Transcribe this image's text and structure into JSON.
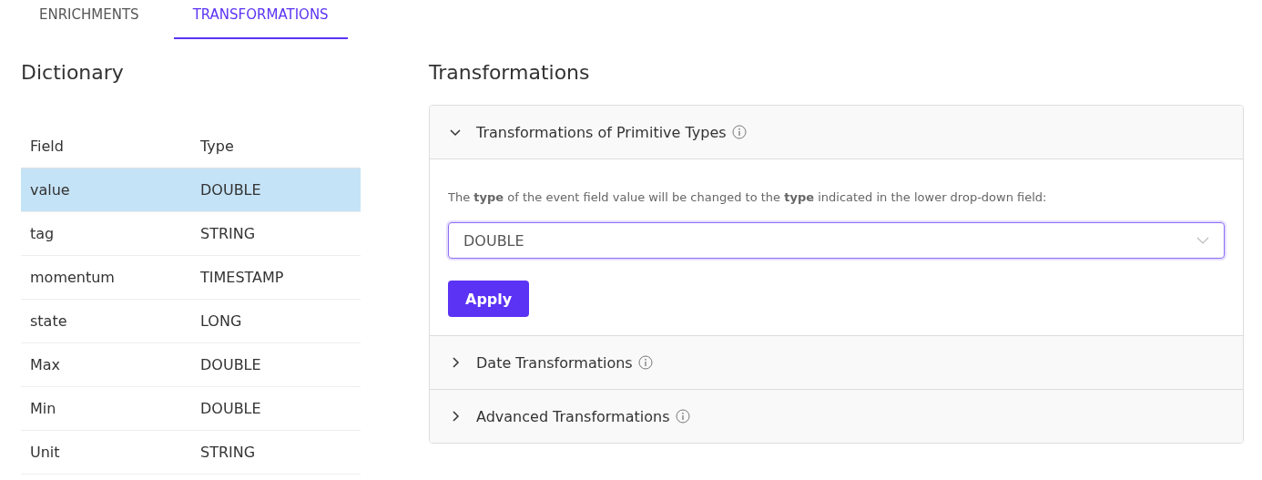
{
  "tabs": [
    {
      "label": "ENRICHMENTS",
      "selected": false
    },
    {
      "label": "TRANSFORMATIONS",
      "selected": true
    }
  ],
  "dictionary": {
    "title": "Dictionary",
    "columns": [
      "Field",
      "Type"
    ],
    "rows": [
      {
        "cells": [
          "value",
          "DOUBLE"
        ],
        "selected": true
      },
      {
        "cells": [
          "tag",
          "STRING"
        ],
        "selected": false
      },
      {
        "cells": [
          "momentum",
          "TIMESTAMP"
        ],
        "selected": false
      },
      {
        "cells": [
          "state",
          "LONG"
        ],
        "selected": false
      },
      {
        "cells": [
          "Max",
          "DOUBLE"
        ],
        "selected": false
      },
      {
        "cells": [
          "Min",
          "DOUBLE"
        ],
        "selected": false
      },
      {
        "cells": [
          "Unit",
          "STRING"
        ],
        "selected": false
      }
    ]
  },
  "transformations": {
    "title": "Transformations",
    "sections": [
      {
        "title": "Transformations of Primitive Types",
        "expanded": true,
        "description": "The **type** of the event field value will be changed to the **type** indicated in the lower drop-down field:",
        "select_value": "DOUBLE",
        "button": "Apply"
      },
      {
        "title": "Date Transformations",
        "expanded": false
      },
      {
        "title": "Advanced Transformations",
        "expanded": false
      }
    ]
  }
}
